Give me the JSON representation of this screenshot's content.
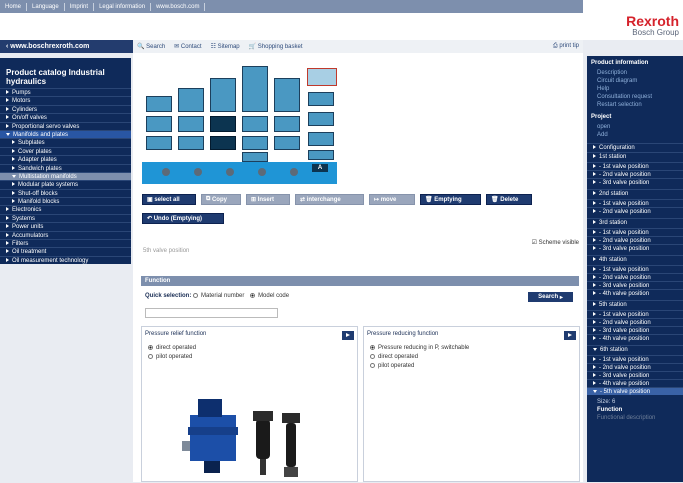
{
  "top_nav": [
    "Home",
    "Language",
    "Imprint",
    "Legal information",
    "www.bosch.com"
  ],
  "logo": {
    "line1": "Rexroth",
    "line2": "Bosch Group"
  },
  "left": {
    "url": "www.boschrexroth.com",
    "catalog_title": "Product catalog Industrial hydraulics",
    "items": [
      {
        "label": "Pumps",
        "level": 0,
        "state": ""
      },
      {
        "label": "Motors",
        "level": 0,
        "state": ""
      },
      {
        "label": "Cylinders",
        "level": 0,
        "state": ""
      },
      {
        "label": "On/off valves",
        "level": 0,
        "state": ""
      },
      {
        "label": "Proportional servo valves",
        "level": 0,
        "state": ""
      },
      {
        "label": "Manifolds and plates",
        "level": 0,
        "state": "open"
      },
      {
        "label": "Subplates",
        "level": 1,
        "state": ""
      },
      {
        "label": "Cover plates",
        "level": 1,
        "state": ""
      },
      {
        "label": "Adapter plates",
        "level": 1,
        "state": ""
      },
      {
        "label": "Sandwich plates",
        "level": 1,
        "state": ""
      },
      {
        "label": "Multistation manifolds",
        "level": 1,
        "state": "current"
      },
      {
        "label": "Modular plate systems",
        "level": 1,
        "state": ""
      },
      {
        "label": "Shut-off blocks",
        "level": 1,
        "state": ""
      },
      {
        "label": "Manifold blocks",
        "level": 1,
        "state": ""
      },
      {
        "label": "Electronics",
        "level": 0,
        "state": ""
      },
      {
        "label": "Systems",
        "level": 0,
        "state": ""
      },
      {
        "label": "Power units",
        "level": 0,
        "state": ""
      },
      {
        "label": "Accumulators",
        "level": 0,
        "state": ""
      },
      {
        "label": "Filters",
        "level": 0,
        "state": ""
      },
      {
        "label": "Oil treatment",
        "level": 0,
        "state": ""
      },
      {
        "label": "Oil measurement technology",
        "level": 0,
        "state": ""
      }
    ]
  },
  "toolbar": {
    "search": "Search",
    "contact": "Contact",
    "sitemap": "Sitemap",
    "basket": "Shopping basket",
    "print": "print tip"
  },
  "config_label": "A",
  "actions": {
    "select_all": "select all",
    "copy": "Copy",
    "insert": "Insert",
    "interchange": "interchange",
    "move": "move",
    "emptying": "Emptying",
    "delete": "Delete",
    "undo": "Undo (Emptying)"
  },
  "position_label": "5th valve position",
  "scheme_visible": "Scheme visible",
  "function": {
    "header": "Function",
    "quick_label": "Quick selection:",
    "opt_material": "Material number",
    "opt_model": "Model code",
    "search_btn": "Search",
    "panel1": {
      "title": "Pressure relief function",
      "options": [
        "direct operated",
        "pilot operated"
      ]
    },
    "panel2": {
      "title": "Pressure reducing function",
      "options": [
        "Pressure reducing in P, switchable",
        "direct operated",
        "pilot operated"
      ]
    }
  },
  "right": {
    "product_info": "Product information",
    "info_links": [
      "Description",
      "Circuit diagram",
      "Help",
      "Consultation request",
      "Restart selection"
    ],
    "project": "Project",
    "project_links": [
      "open",
      "Add"
    ],
    "configuration": "Configuration",
    "stations": [
      {
        "name": "1st station",
        "positions": [
          "- 1st valve position",
          "- 2nd valve position",
          "- 3rd valve position"
        ]
      },
      {
        "name": "2nd station",
        "positions": [
          "- 1st valve position",
          "- 2nd valve position"
        ]
      },
      {
        "name": "3rd station",
        "positions": [
          "- 1st valve position",
          "- 2nd valve position",
          "- 3rd valve position"
        ]
      },
      {
        "name": "4th station",
        "positions": [
          "- 1st valve position",
          "- 2nd valve position",
          "- 3rd valve position",
          "- 4th valve position"
        ]
      },
      {
        "name": "5th station",
        "positions": [
          "- 1st valve position",
          "- 2nd valve position",
          "- 3rd valve position",
          "- 4th valve position"
        ]
      },
      {
        "name": "6th station",
        "positions": [
          "- 1st valve position",
          "- 2nd valve position",
          "- 3rd valve position",
          "- 4th valve position",
          "- 5th valve position"
        ]
      }
    ],
    "size": "Size: 6",
    "function": "Function",
    "functional_description": "Functional description"
  },
  "colors": {
    "navy": "#0f2a5a",
    "accent": "#1f3b70",
    "brand_red": "#d5222b",
    "blue_block": "#4a98c2"
  }
}
